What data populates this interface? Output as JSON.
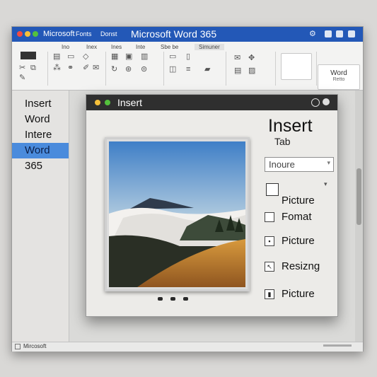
{
  "colors": {
    "title_bar": "#2358b7",
    "selection": "#4a8bdc",
    "dialog_header": "#2f2f2f"
  },
  "window": {
    "menu": [
      "Microsoft",
      "Fonts",
      "Donst"
    ],
    "title": "Microsoft  Word 365",
    "controls": [
      "settings-icon",
      "minimize-icon",
      "maximize-icon",
      "close-icon"
    ]
  },
  "ribbon": {
    "tabs": [
      "Ino",
      "Inex",
      "Ines",
      "Inte",
      "Sbe be",
      "Simuner"
    ],
    "button_word": "Word",
    "button_word_sub": "Retto"
  },
  "sidebar": {
    "items": [
      "Insert",
      "Word",
      "Intere",
      "Word",
      "365"
    ],
    "selected_index": 3
  },
  "dialog": {
    "title": "Insert",
    "heading": "Insert",
    "subheading": "Tab",
    "combo_value": "Inoure",
    "options": [
      "Picture",
      "Fomat",
      "Picture",
      "Resizng",
      "Picture"
    ]
  },
  "statusbar": {
    "left": "Mircosoft"
  }
}
